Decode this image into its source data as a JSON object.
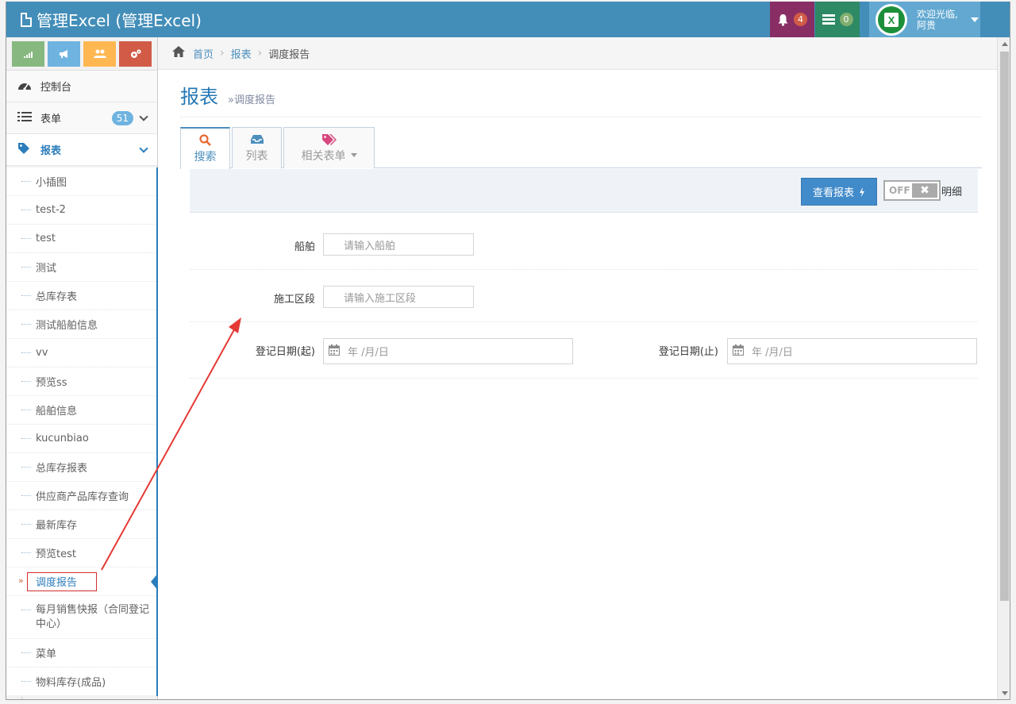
{
  "navbar": {
    "title": "管理Excel (管理Excel)",
    "bell_count": "4",
    "msg_count": "0",
    "welcome": "欢迎光临,",
    "username": "阿贵"
  },
  "sidebar": {
    "shortcut_icons": [
      "signal-icon",
      "bullhorn-icon",
      "users-icon",
      "cogs-icon"
    ],
    "items": [
      {
        "label": "控制台",
        "icon": "dashboard-icon"
      },
      {
        "label": "表单",
        "icon": "list-icon",
        "count": "51"
      },
      {
        "label": "报表",
        "icon": "tag-icon"
      }
    ],
    "submenu": [
      "小插图",
      "test-2",
      "test",
      "测试",
      "总库存表",
      "测试船舶信息",
      "vv",
      "预览ss",
      "船舶信息",
      "kucunbiao",
      "总库存报表",
      "供应商产品库存查询",
      "最新库存",
      "预览test",
      "调度报告",
      "每月销售快报（合同登记中心）",
      "菜单",
      "物料库存(成品)"
    ],
    "current": "调度报告"
  },
  "breadcrumb": {
    "home": "首页",
    "section": "报表",
    "current": "调度报告"
  },
  "page": {
    "title": "报表",
    "subtitle": "»调度报告"
  },
  "tabs": [
    {
      "label": "搜索",
      "icon": "search-icon"
    },
    {
      "label": "列表",
      "icon": "inbox-icon"
    },
    {
      "label": "相关表单",
      "icon": "tags-icon"
    }
  ],
  "toolbar": {
    "view_button": "查看报表",
    "toggle_state": "OFF",
    "toggle_label": "明细"
  },
  "form": {
    "ship_label": "船舶",
    "ship_placeholder": "请输入船舶",
    "section_label": "施工区段",
    "section_placeholder": "请输入施工区段",
    "date_start_label": "登记日期(起)",
    "date_end_label": "登记日期(止)",
    "date_placeholder": "年 /月/日"
  },
  "colors": {
    "navbar": "#438eb9",
    "accent": "#2b7dbc",
    "annotation": "#e53935"
  }
}
